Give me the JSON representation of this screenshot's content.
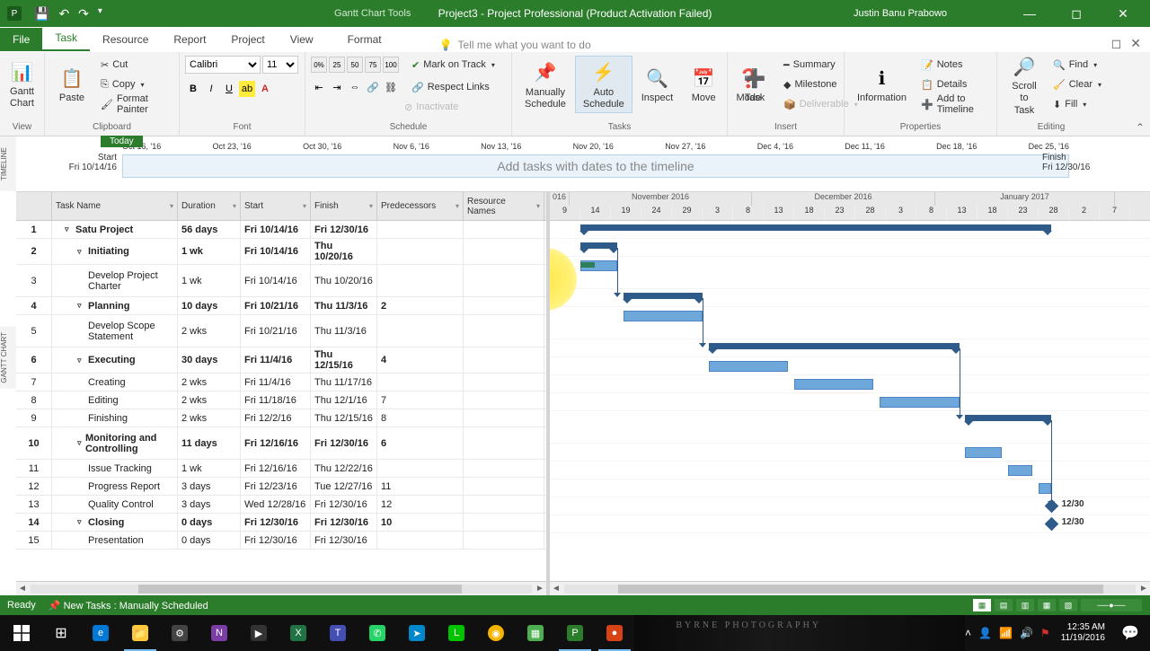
{
  "titlebar": {
    "tools_title": "Gantt Chart Tools",
    "window_title": "Project3 - Project Professional (Product Activation Failed)",
    "user": "Justin Banu Prabowo"
  },
  "ribbon_tabs": {
    "file": "File",
    "task": "Task",
    "resource": "Resource",
    "report": "Report",
    "project": "Project",
    "view": "View",
    "format": "Format",
    "tellme": "Tell me what you want to do"
  },
  "ribbon": {
    "view_label": "View",
    "gantt_chart": "Gantt\nChart",
    "paste": "Paste",
    "cut": "Cut",
    "copy": "Copy",
    "format_painter": "Format Painter",
    "clipboard": "Clipboard",
    "font_name": "Calibri",
    "font_size": "11",
    "font": "Font",
    "schedule": "Schedule",
    "mark_on_track": "Mark on Track",
    "respect_links": "Respect Links",
    "inactivate": "Inactivate",
    "manually_schedule": "Manually\nSchedule",
    "auto_schedule": "Auto\nSchedule",
    "inspect": "Inspect",
    "move": "Move",
    "mode": "Mode",
    "tasks": "Tasks",
    "task_btn": "Task",
    "summary": "Summary",
    "milestone": "Milestone",
    "deliverable": "Deliverable",
    "insert": "Insert",
    "information": "Information",
    "notes": "Notes",
    "details": "Details",
    "add_to_timeline": "Add to Timeline",
    "properties": "Properties",
    "scroll_to_task": "Scroll\nto Task",
    "find": "Find",
    "clear": "Clear",
    "fill": "Fill",
    "editing": "Editing"
  },
  "timeline": {
    "today": "Today",
    "start_label": "Start",
    "start_date": "Fri 10/14/16",
    "finish_label": "Finish",
    "finish_date": "Fri 12/30/16",
    "prompt": "Add tasks with dates to the timeline",
    "scale": [
      "Oct 16, '16",
      "Oct 23, '16",
      "Oct 30, '16",
      "Nov 6, '16",
      "Nov 13, '16",
      "Nov 20, '16",
      "Nov 27, '16",
      "Dec 4, '16",
      "Dec 11, '16",
      "Dec 18, '16",
      "Dec 25, '16"
    ]
  },
  "columns": {
    "task_name": "Task Name",
    "duration": "Duration",
    "start": "Start",
    "finish": "Finish",
    "predecessors": "Predecessors",
    "resource_names": "Resource Names"
  },
  "gantt_header": {
    "partial": "016",
    "months": [
      "November 2016",
      "December 2016",
      "January 2017"
    ],
    "days": [
      "9",
      "14",
      "19",
      "24",
      "29",
      "3",
      "8",
      "13",
      "18",
      "23",
      "28",
      "3",
      "8",
      "13",
      "18",
      "23",
      "28",
      "2",
      "7"
    ]
  },
  "tasks": [
    {
      "n": "1",
      "name": "Satu Project",
      "dur": "56 days",
      "start": "Fri 10/14/16",
      "fin": "Fri 12/30/16",
      "pred": "",
      "lvl": 0,
      "sum": true
    },
    {
      "n": "2",
      "name": "Initiating",
      "dur": "1 wk",
      "start": "Fri 10/14/16",
      "fin": "Thu 10/20/16",
      "pred": "",
      "lvl": 1,
      "sum": true
    },
    {
      "n": "3",
      "name": "Develop Project Charter",
      "dur": "1 wk",
      "start": "Fri 10/14/16",
      "fin": "Thu 10/20/16",
      "pred": "",
      "lvl": 2,
      "sum": false,
      "h2": true
    },
    {
      "n": "4",
      "name": "Planning",
      "dur": "10 days",
      "start": "Fri 10/21/16",
      "fin": "Thu 11/3/16",
      "pred": "2",
      "lvl": 1,
      "sum": true
    },
    {
      "n": "5",
      "name": "Develop Scope Statement",
      "dur": "2 wks",
      "start": "Fri 10/21/16",
      "fin": "Thu 11/3/16",
      "pred": "",
      "lvl": 2,
      "sum": false,
      "h2": true
    },
    {
      "n": "6",
      "name": "Executing",
      "dur": "30 days",
      "start": "Fri 11/4/16",
      "fin": "Thu 12/15/16",
      "pred": "4",
      "lvl": 1,
      "sum": true
    },
    {
      "n": "7",
      "name": "Creating",
      "dur": "2 wks",
      "start": "Fri 11/4/16",
      "fin": "Thu 11/17/16",
      "pred": "",
      "lvl": 2,
      "sum": false
    },
    {
      "n": "8",
      "name": "Editing",
      "dur": "2 wks",
      "start": "Fri 11/18/16",
      "fin": "Thu 12/1/16",
      "pred": "7",
      "lvl": 2,
      "sum": false
    },
    {
      "n": "9",
      "name": "Finishing",
      "dur": "2 wks",
      "start": "Fri 12/2/16",
      "fin": "Thu 12/15/16",
      "pred": "8",
      "lvl": 2,
      "sum": false
    },
    {
      "n": "10",
      "name": "Monitoring and Controlling",
      "dur": "11 days",
      "start": "Fri 12/16/16",
      "fin": "Fri 12/30/16",
      "pred": "6",
      "lvl": 1,
      "sum": true,
      "h2": true
    },
    {
      "n": "11",
      "name": "Issue Tracking",
      "dur": "1 wk",
      "start": "Fri 12/16/16",
      "fin": "Thu 12/22/16",
      "pred": "",
      "lvl": 2,
      "sum": false
    },
    {
      "n": "12",
      "name": "Progress Report",
      "dur": "3 days",
      "start": "Fri 12/23/16",
      "fin": "Tue 12/27/16",
      "pred": "11",
      "lvl": 2,
      "sum": false
    },
    {
      "n": "13",
      "name": "Quality Control",
      "dur": "3 days",
      "start": "Wed 12/28/16",
      "fin": "Fri 12/30/16",
      "pred": "12",
      "lvl": 2,
      "sum": false
    },
    {
      "n": "14",
      "name": "Closing",
      "dur": "0 days",
      "start": "Fri 12/30/16",
      "fin": "Fri 12/30/16",
      "pred": "10",
      "lvl": 1,
      "sum": true
    },
    {
      "n": "15",
      "name": "Presentation",
      "dur": "0 days",
      "start": "Fri 12/30/16",
      "fin": "Fri 12/30/16",
      "pred": "",
      "lvl": 2,
      "sum": false
    }
  ],
  "milestone_labels": {
    "r14": "12/30",
    "r15": "12/30"
  },
  "statusbar": {
    "ready": "Ready",
    "new_tasks": "New Tasks : Manually Scheduled"
  },
  "clock": {
    "time": "12:35 AM",
    "date": "11/19/2016"
  },
  "watermark": "BYRNE PHOTOGRAPHY"
}
